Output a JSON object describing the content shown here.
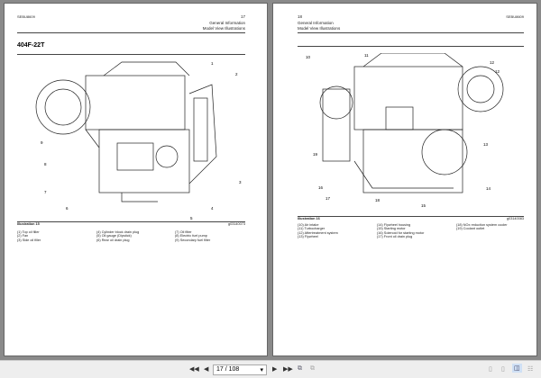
{
  "left_page": {
    "doc_id": "SEBU8609",
    "page_number": "17",
    "section": "General Information",
    "subsection": "Model View Illustrations",
    "model_heading": "404F-22T",
    "illustration_label": "Illustration 15",
    "image_id": "g03140073",
    "callouts": [
      "1",
      "2",
      "3",
      "4",
      "5",
      "6",
      "7",
      "8",
      "9"
    ],
    "legend": [
      "(1) Top oil filler",
      "(2) Fan",
      "(3) Side oil filler",
      "(4) Cylinder block drain plug",
      "(5) Oil gauge (Dipstick)",
      "(6) Rear oil drain plug",
      "(7) Oil filter",
      "(8) Electric fuel pump",
      "(9) Secondary fuel filter"
    ]
  },
  "right_page": {
    "page_number": "18",
    "doc_id": "SEBU8609",
    "section": "General Information",
    "subsection": "Model View Illustrations",
    "illustration_label": "Illustration 16",
    "image_id": "g03140083",
    "callouts": [
      "10",
      "11",
      "12",
      "12",
      "13",
      "14",
      "15",
      "16",
      "17",
      "18",
      "19"
    ],
    "legend": [
      "(10) Air intake",
      "(11) Turbocharger",
      "(12) Aftertreatment system",
      "(13) Flywheel",
      "(14) Flywheel housing",
      "(15) Starting motor",
      "(16) Solenoid for starting motor",
      "(17) Front oil drain plug",
      "(18) NOx reduction system cooler",
      "(19) Coolant outlet"
    ]
  },
  "toolbar": {
    "page_field": "17 / 108"
  }
}
